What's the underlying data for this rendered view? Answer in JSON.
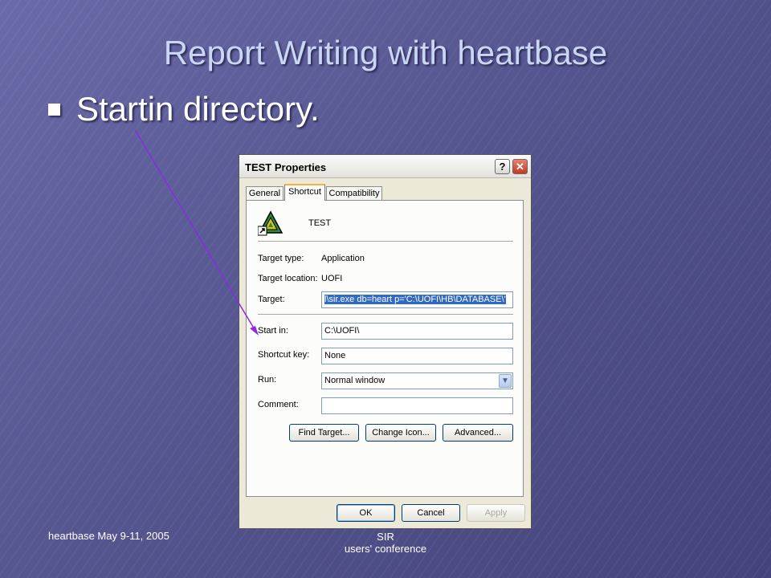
{
  "slide": {
    "title": "Report Writing with heartbase",
    "bullet": "Startin directory.",
    "footer_left": "heartbase   May 9-11,  2005",
    "footer_center_line1": "SIR",
    "footer_center_line2": "users' conference",
    "arrow_color": "#8a2be2"
  },
  "dialog": {
    "title": "TEST Properties",
    "help_label": "?",
    "close_label": "✕",
    "tabs": [
      {
        "label": "General"
      },
      {
        "label": "Shortcut",
        "active": true
      },
      {
        "label": "Compatibility"
      }
    ],
    "app_name": "TEST",
    "fields": {
      "target_type_label": "Target type:",
      "target_type_value": "Application",
      "target_location_label": "Target location:",
      "target_location_value": "UOFI",
      "target_label": "Target:",
      "target_value": "l\\sir.exe db=heart p='C:\\UOFI\\HB\\DATABASE\\'",
      "start_in_label": "Start in:",
      "start_in_value": "C:\\UOFI\\",
      "shortcut_key_label": "Shortcut key:",
      "shortcut_key_value": "None",
      "run_label": "Run:",
      "run_value": "Normal window",
      "comment_label": "Comment:",
      "comment_value": ""
    },
    "buttons": {
      "find_target": "Find Target...",
      "change_icon": "Change Icon...",
      "advanced": "Advanced...",
      "ok": "OK",
      "cancel": "Cancel",
      "apply": "Apply"
    },
    "icons": {
      "app": "triangle-app-icon",
      "shortcut_overlay": "shortcut-arrow-icon",
      "dropdown": "chevron-down-icon"
    }
  }
}
